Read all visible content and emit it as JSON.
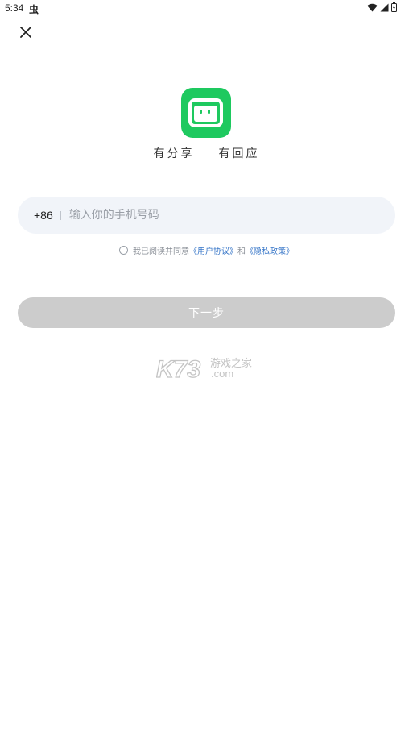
{
  "status_bar": {
    "time": "5:34",
    "notification_glyph": "虫"
  },
  "app": {
    "tagline_left": "有分享",
    "tagline_right": "有回应",
    "logo_color": "#1ec95f"
  },
  "phone": {
    "country_code": "+86",
    "placeholder": "输入你的手机号码",
    "value": ""
  },
  "agreement": {
    "prefix": "我已阅读并同意",
    "user_agreement": "《用户协议》",
    "joiner": "和",
    "privacy_policy": "《隐私政策》",
    "link_color": "#3a78c9"
  },
  "next_button": {
    "label": "下一步",
    "color": "#cccccc"
  },
  "watermark": {
    "brand": "K73",
    "cn_text": "游戏之家",
    "domain": ".com"
  }
}
